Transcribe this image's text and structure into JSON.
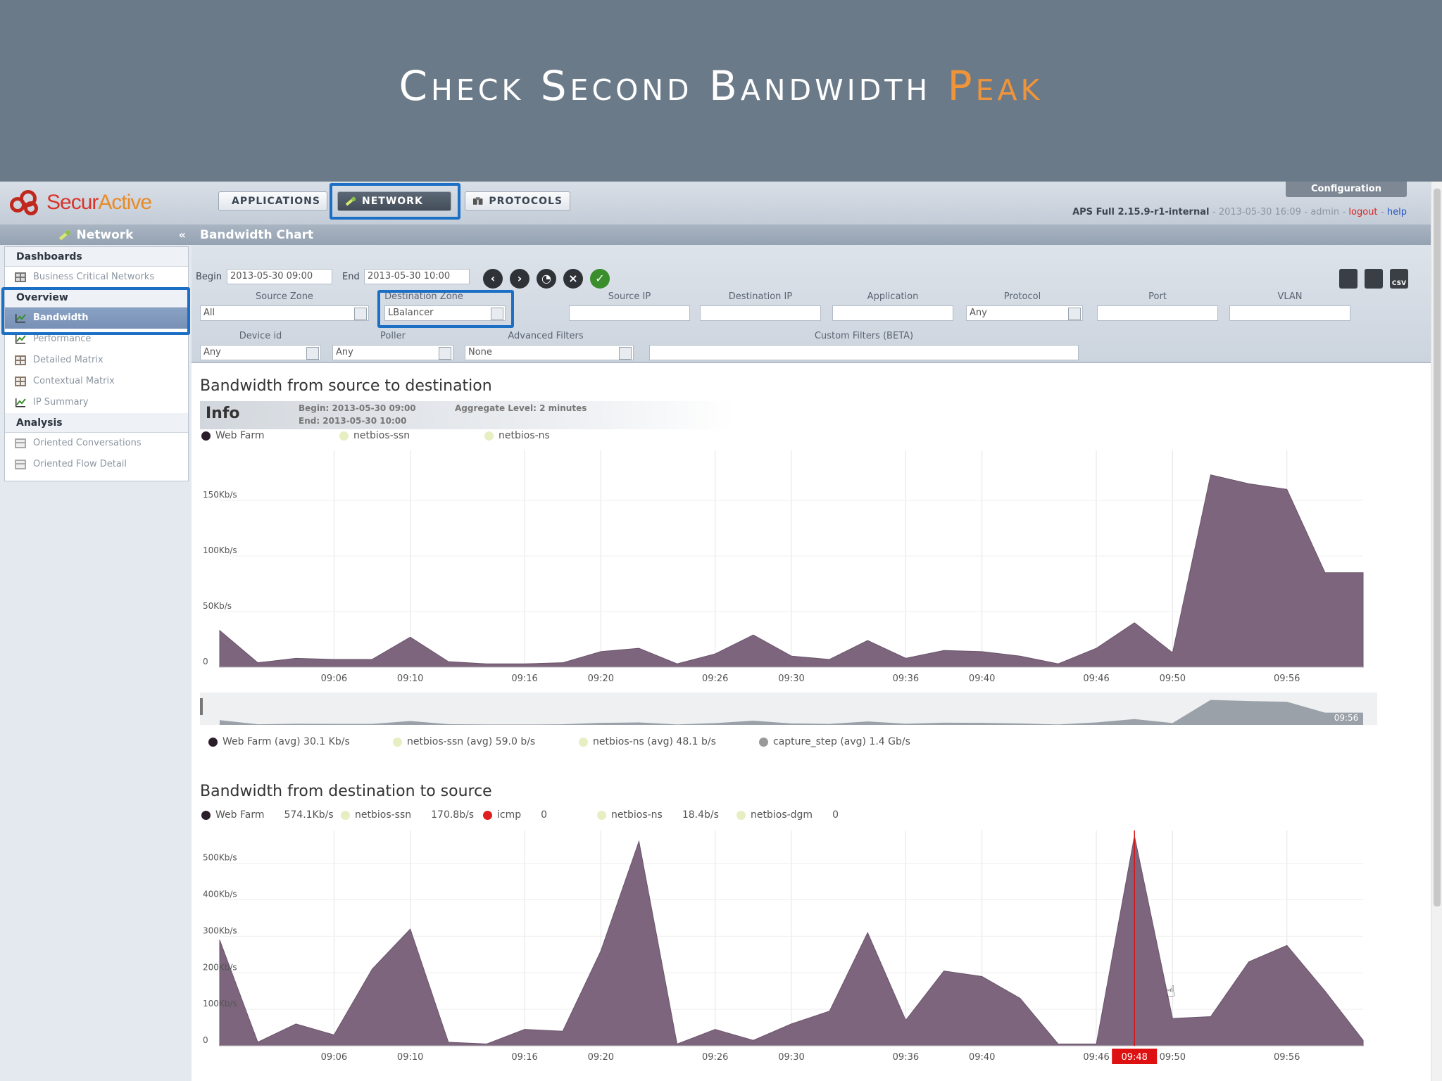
{
  "slide": {
    "title_main": "Check Second Bandwidth ",
    "title_accent": "Peak"
  },
  "topbar": {
    "logo_main": "Secur",
    "logo_accent": "Active",
    "tabs": [
      {
        "label": "APPLICATIONS",
        "icon": "chart-icon"
      },
      {
        "label": "NETWORK",
        "icon": "network-icon"
      },
      {
        "label": "PROTOCOLS",
        "icon": "protocols-icon"
      }
    ],
    "configuration": "Configuration",
    "version": "APS Full 2.15.9-r1-internal",
    "timestamp": "2013-05-30 16:09",
    "user": "admin",
    "logout": "logout",
    "help": "help"
  },
  "sidebar": {
    "title": "Network",
    "groups": [
      {
        "label": "Dashboards",
        "items": [
          {
            "label": "Business Critical Networks"
          }
        ]
      },
      {
        "label": "Overview",
        "items": [
          {
            "label": "Bandwidth",
            "selected": true
          },
          {
            "label": "Performance"
          },
          {
            "label": "Detailed Matrix"
          },
          {
            "label": "Contextual Matrix"
          },
          {
            "label": "IP Summary"
          }
        ]
      },
      {
        "label": "Analysis",
        "items": [
          {
            "label": "Oriented Conversations"
          },
          {
            "label": "Oriented Flow Detail"
          }
        ]
      }
    ]
  },
  "main": {
    "title": "Bandwidth Chart",
    "begin_label": "Begin",
    "begin_value": "2013-05-30 09:00",
    "end_label": "End",
    "end_value": "2013-05-30 10:00",
    "filters_row1": [
      {
        "label": "Source Zone",
        "value": "All"
      },
      {
        "label": "Destination Zone",
        "value": "LBalancer"
      },
      {
        "label": "Source IP",
        "value": ""
      },
      {
        "label": "Destination IP",
        "value": ""
      },
      {
        "label": "Application",
        "value": ""
      },
      {
        "label": "Protocol",
        "value": "Any"
      },
      {
        "label": "Port",
        "value": ""
      },
      {
        "label": "VLAN",
        "value": ""
      }
    ],
    "filters_row2": [
      {
        "label": "Device id",
        "value": "Any"
      },
      {
        "label": "Poller",
        "value": "Any"
      },
      {
        "label": "Advanced Filters",
        "value": "None"
      },
      {
        "label": "Custom Filters (BETA)",
        "value": ""
      }
    ]
  },
  "info": {
    "label": "Info",
    "begin": "Begin: 2013-05-30 09:00",
    "end": "End: 2013-05-30 10:00",
    "aggregate": "Aggregate Level: 2 minutes"
  },
  "colors": {
    "area": "#7d667d",
    "web_farm": "#2b1e2b",
    "netbios": "#e7eec2",
    "icmp": "#e02020",
    "capture": "#999999",
    "highlight": "#1b6fc4"
  },
  "chart_data": [
    {
      "type": "area",
      "title": "Bandwidth from source to destination",
      "legend_top": [
        "Web Farm",
        "netbios-ssn",
        "netbios-ns"
      ],
      "legend_bottom": [
        {
          "name": "Web Farm",
          "text": "Web Farm (avg) 30.1 Kb/s"
        },
        {
          "name": "netbios-ssn",
          "text": "netbios-ssn (avg) 59.0 b/s"
        },
        {
          "name": "netbios-ns",
          "text": "netbios-ns (avg) 48.1 b/s"
        },
        {
          "name": "capture_step",
          "text": "capture_step (avg) 1.4 Gb/s"
        }
      ],
      "y_ticks": [
        "0",
        "50Kb/s",
        "100Kb/s",
        "150Kb/s"
      ],
      "y_tick_values": [
        0,
        50,
        100,
        150
      ],
      "ylim": [
        0,
        195
      ],
      "x_range": [
        0,
        60
      ],
      "x_ticks": [
        "09:06",
        "09:10",
        "09:16",
        "09:20",
        "09:26",
        "09:30",
        "09:36",
        "09:40",
        "09:46",
        "09:50",
        "09:56"
      ],
      "x_tick_values": [
        6,
        10,
        16,
        20,
        26,
        30,
        36,
        40,
        46,
        50,
        56
      ],
      "navigator_label": "09:56",
      "series": [
        {
          "name": "Web Farm",
          "x": [
            0,
            2,
            4,
            6,
            8,
            10,
            12,
            14,
            16,
            18,
            20,
            22,
            24,
            26,
            28,
            30,
            32,
            34,
            36,
            38,
            40,
            42,
            44,
            46,
            48,
            50,
            52,
            54,
            56,
            58,
            60
          ],
          "values": [
            33,
            4,
            8,
            7,
            7,
            27,
            5,
            3,
            3,
            4,
            14,
            17,
            3,
            12,
            29,
            10,
            7,
            24,
            8,
            15,
            14,
            10,
            3,
            17,
            40,
            13,
            173,
            165,
            160,
            85,
            85
          ]
        }
      ]
    },
    {
      "type": "area",
      "title": "Bandwidth from destination to source",
      "legend_top": [
        {
          "name": "Web Farm",
          "value": "574.1Kb/s"
        },
        {
          "name": "netbios-ssn",
          "value": "170.8b/s"
        },
        {
          "name": "icmp",
          "value": "0"
        },
        {
          "name": "netbios-ns",
          "value": "18.4b/s"
        },
        {
          "name": "netbios-dgm",
          "value": "0"
        }
      ],
      "y_ticks": [
        "0",
        "100Kb/s",
        "200Kb/s",
        "300Kb/s",
        "400Kb/s",
        "500Kb/s"
      ],
      "y_tick_values": [
        0,
        100,
        200,
        300,
        400,
        500
      ],
      "ylim": [
        0,
        590
      ],
      "x_range": [
        0,
        60
      ],
      "x_ticks": [
        "09:06",
        "09:10",
        "09:16",
        "09:20",
        "09:26",
        "09:30",
        "09:36",
        "09:40",
        "09:46",
        "09:48",
        "09:50",
        "09:56"
      ],
      "x_tick_values": [
        6,
        10,
        16,
        20,
        26,
        30,
        36,
        40,
        46,
        48,
        50,
        56
      ],
      "crosshair": "09:48",
      "series": [
        {
          "name": "Web Farm",
          "x": [
            0,
            2,
            4,
            6,
            8,
            10,
            12,
            14,
            16,
            18,
            20,
            22,
            24,
            26,
            28,
            30,
            32,
            34,
            36,
            38,
            40,
            42,
            44,
            46,
            48,
            50,
            52,
            54,
            56,
            58,
            60
          ],
          "values": [
            290,
            10,
            60,
            30,
            210,
            320,
            10,
            5,
            45,
            40,
            260,
            560,
            5,
            45,
            15,
            60,
            95,
            310,
            70,
            205,
            190,
            130,
            5,
            5,
            575,
            75,
            80,
            230,
            275,
            150,
            15
          ]
        }
      ]
    }
  ]
}
